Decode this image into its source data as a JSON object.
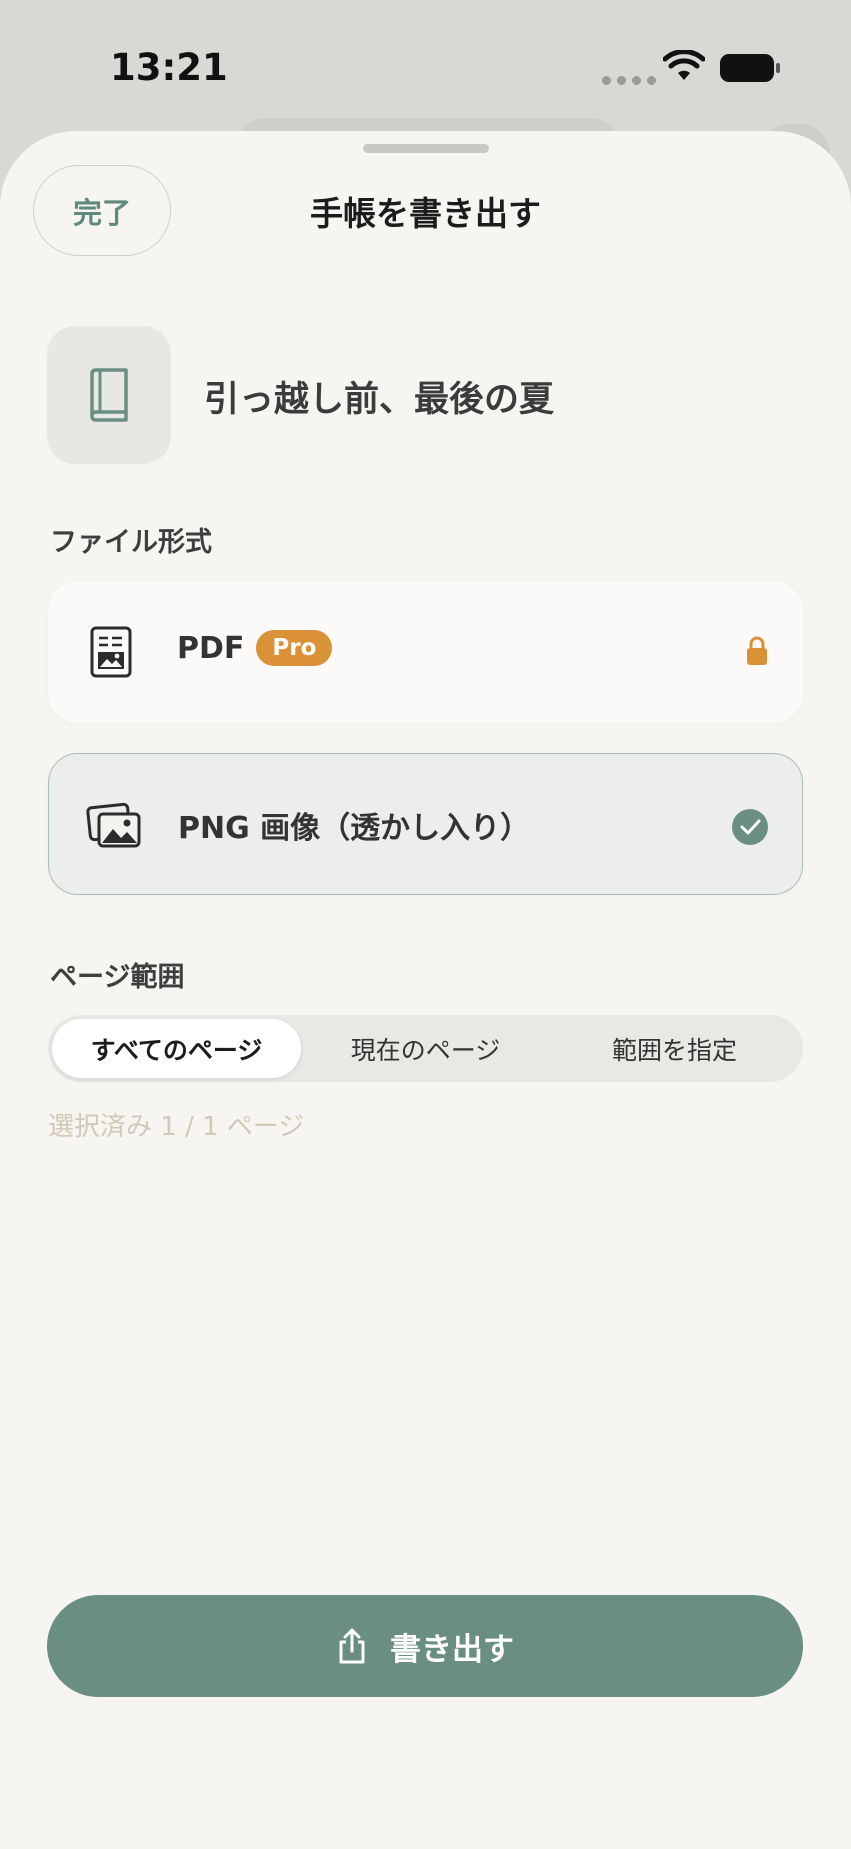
{
  "status_bar": {
    "time": "13:21"
  },
  "header": {
    "done_label": "完了",
    "title": "手帳を書き出す"
  },
  "journal": {
    "name": "引っ越し前、最後の夏",
    "icon": "book-icon"
  },
  "file_format": {
    "label": "ファイル形式",
    "options": [
      {
        "label": "PDF",
        "badge": "Pro",
        "icon": "pdf-document-icon",
        "state": "locked"
      },
      {
        "label": "PNG 画像（透かし入り）",
        "icon": "image-stack-icon",
        "state": "selected"
      }
    ]
  },
  "page_range": {
    "label": "ページ範囲",
    "segments": [
      "すべてのページ",
      "現在のページ",
      "範囲を指定"
    ],
    "active_index": 0,
    "selected_count": "選択済み 1 / 1 ページ"
  },
  "export": {
    "label": "書き出す",
    "icon": "share-icon"
  },
  "colors": {
    "accent": "#6a8f82",
    "pro_badge": "#db9138",
    "sheet_bg": "#f6f5f1"
  }
}
